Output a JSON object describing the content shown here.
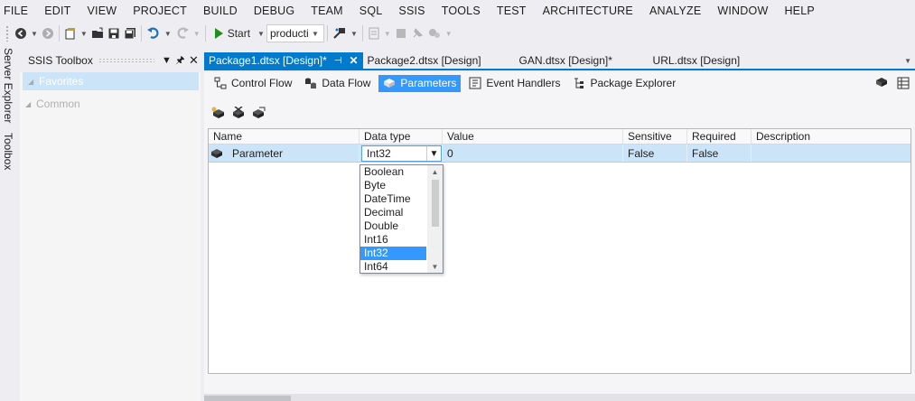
{
  "menu": [
    "FILE",
    "EDIT",
    "VIEW",
    "PROJECT",
    "BUILD",
    "DEBUG",
    "TEAM",
    "SQL",
    "SSIS",
    "TOOLS",
    "TEST",
    "ARCHITECTURE",
    "ANALYZE",
    "WINDOW",
    "HELP"
  ],
  "toolbar": {
    "start_label": "Start",
    "config_value": "producti"
  },
  "side_tabs": {
    "server_explorer": "Server Explorer",
    "toolbox": "Toolbox"
  },
  "toolbox": {
    "title": "SSIS Toolbox",
    "groups": [
      "Favorites",
      "Common"
    ]
  },
  "doc_tabs": [
    "Package1.dtsx [Design]*",
    "Package2.dtsx [Design]",
    "GAN.dtsx [Design]*",
    "URL.dtsx [Design]"
  ],
  "designer_tabs": [
    "Control Flow",
    "Data Flow",
    "Parameters",
    "Event Handlers",
    "Package Explorer"
  ],
  "grid": {
    "columns": [
      "Name",
      "Data type",
      "Value",
      "Sensitive",
      "Required",
      "Description"
    ],
    "row": {
      "name": "Parameter",
      "data_type": "Int32",
      "value": "0",
      "sensitive": "False",
      "required": "False",
      "description": ""
    }
  },
  "type_options": [
    "Boolean",
    "Byte",
    "DateTime",
    "Decimal",
    "Double",
    "Int16",
    "Int32",
    "Int64"
  ],
  "selected_type": "Int32",
  "colors": {
    "accent": "#007acc",
    "selection": "#3399ff",
    "row_highlight": "#cce4f7",
    "start_green": "#1e8e1e"
  },
  "icons": [
    "back-icon",
    "forward-icon",
    "new-project-icon",
    "open-icon",
    "save-icon",
    "save-all-icon",
    "undo-icon",
    "redo-icon",
    "start-icon",
    "attach-icon",
    "comment-icon"
  ]
}
